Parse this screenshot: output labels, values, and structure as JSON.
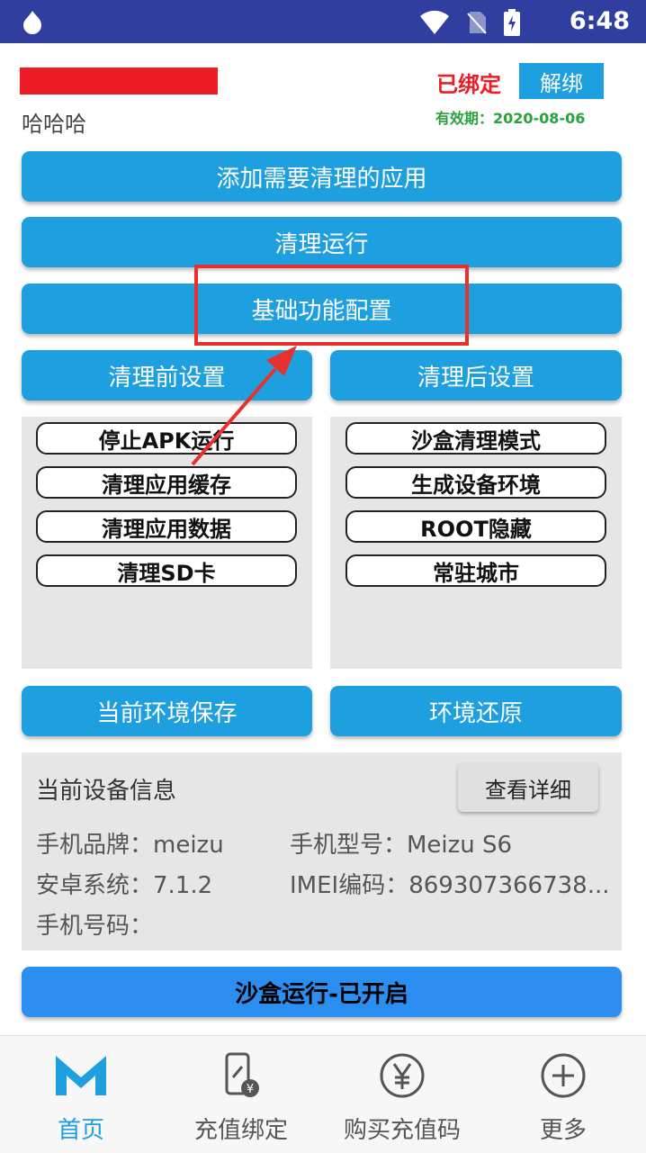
{
  "status_bar": {
    "time": "6:48"
  },
  "header": {
    "username": "哈哈哈",
    "bound_label": "已绑定",
    "unbind_label": "解绑",
    "expiry": "有效期：2020-08-06"
  },
  "buttons": {
    "add_app": "添加需要清理的应用",
    "clean_run": "清理运行",
    "basic_config": "基础功能配置",
    "pre_settings": "清理前设置",
    "post_settings": "清理后设置",
    "save_env": "当前环境保存",
    "restore_env": "环境还原",
    "sandbox_run": "沙盒运行-已开启"
  },
  "pre_options": [
    "停止APK运行",
    "清理应用缓存",
    "清理应用数据",
    "清理SD卡"
  ],
  "post_options": [
    "沙盒清理模式",
    "生成设备环境",
    "ROOT隐藏",
    "常驻城市"
  ],
  "device_info": {
    "title": "当前设备信息",
    "detail_button": "查看详细",
    "brand": "手机品牌：meizu",
    "model": "手机型号：Meizu S6",
    "android": "安卓系统：7.1.2",
    "imei": "IMEI编码：869307366738...",
    "phone": "手机号码："
  },
  "nav": [
    {
      "label": "首页",
      "icon": "m-logo-icon",
      "active": true
    },
    {
      "label": "充值绑定",
      "icon": "phone-recharge-icon",
      "active": false
    },
    {
      "label": "购买充值码",
      "icon": "yen-circle-icon",
      "active": false
    },
    {
      "label": "更多",
      "icon": "plus-circle-icon",
      "active": false
    }
  ],
  "colors": {
    "status_bar": "#303f9f",
    "primary": "#1e9fe0",
    "sandbox": "#2b8ef0",
    "alert_red": "#ee1c25",
    "expiry_green": "#28a33c",
    "annotation": "#e8312f"
  }
}
